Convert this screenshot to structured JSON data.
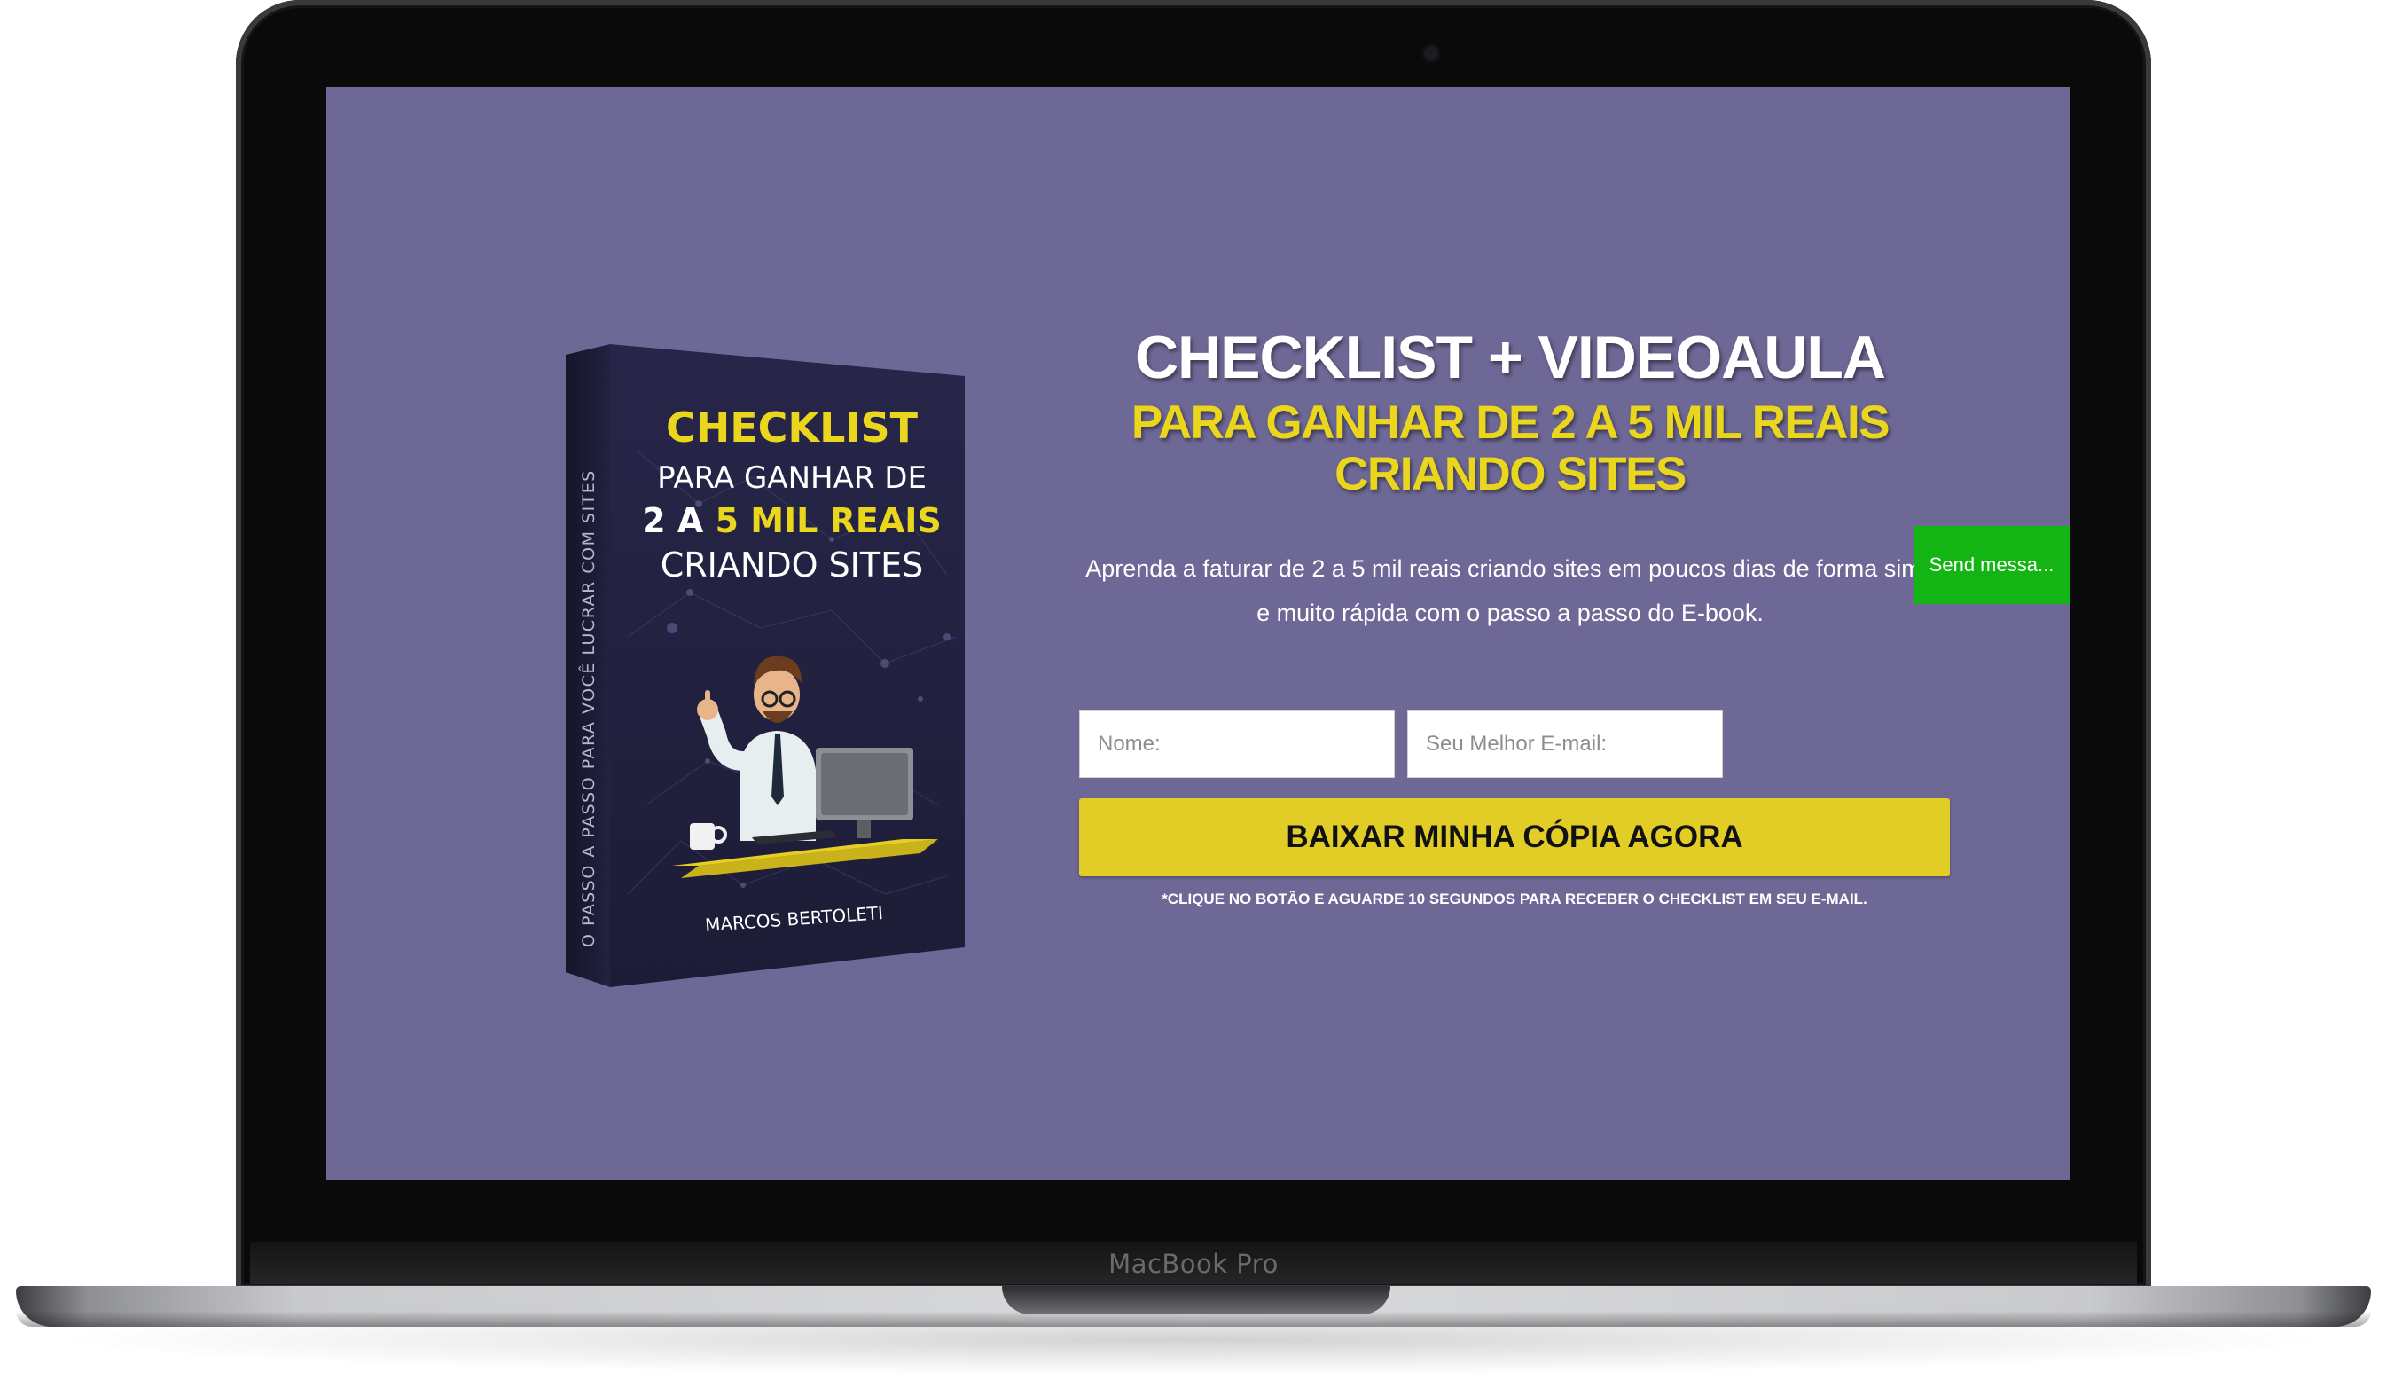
{
  "device": {
    "brand_label": "MacBook Pro"
  },
  "hero": {
    "headline": "CHECKLIST + VIDEOAULA",
    "subheadline_line1": "PARA GANHAR DE 2 A 5 MIL REAIS",
    "subheadline_line2": "CRIANDO SITES",
    "description_line1": "Aprenda a faturar de 2 a 5 mil reais criando sites em poucos dias de forma simp",
    "description_line2": "e muito rápida com o passo a passo do E-book."
  },
  "book_cover": {
    "title": "CHECKLIST",
    "line2": "PARA GANHAR DE",
    "line3_a": "2 A ",
    "line3_b": "5 MIL REAIS",
    "line4": "CRIANDO SITES",
    "spine_text": "O PASSO A PASSO PARA VOCÊ LUCRAR COM SITES",
    "author": "MARCOS BERTOLETI"
  },
  "form": {
    "name_placeholder": "Nome:",
    "email_placeholder": "Seu Melhor E-mail:",
    "submit_label": "BAIXAR MINHA CÓPIA AGORA",
    "disclaimer": "*CLIQUE NO BOTÃO E AGUARDE 10 SEGUNDOS PARA RECEBER O CHECKLIST EM SEU E-MAIL."
  },
  "chat_widget": {
    "label": "Send messa..."
  },
  "colors": {
    "background": "#6e6896",
    "accent_yellow": "#e2cd27",
    "chat_green": "#12b513"
  }
}
